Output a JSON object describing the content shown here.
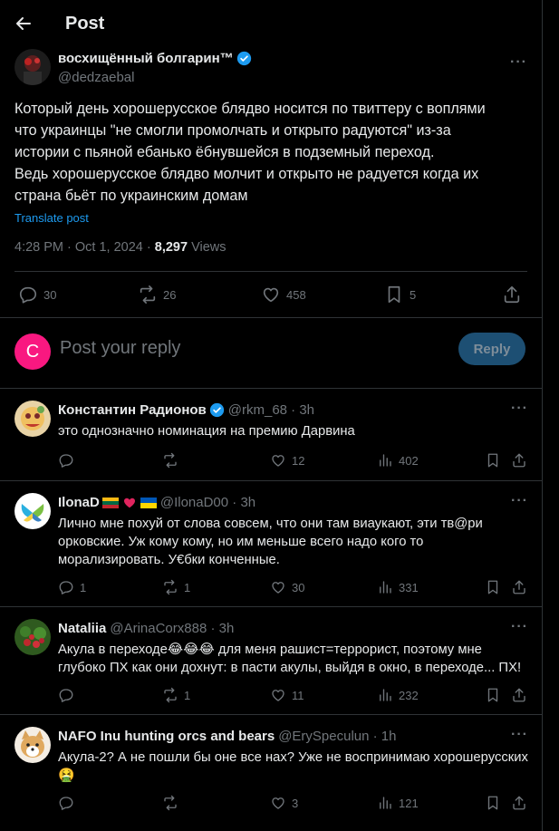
{
  "header": {
    "title": "Post"
  },
  "post": {
    "author_name": "восхищённый болгарин™",
    "author_handle": "@dedzaebal",
    "text_lines": [
      "Который день хорошерусское блядво носится по твиттеру с воплями",
      "что украинцы \"не смогли промолчать и открыто радуются\" из-за",
      "истории с пьяной ебанько ёбнувшейся в подземный переход.",
      "Ведь хорошерусское блядво молчит и открыто не радуется когда их",
      "страна бьёт по украинским домам"
    ],
    "translate": "Translate post",
    "time": "4:28 PM · Oct 1, 2024 · ",
    "views_count": "8,297",
    "views_label": " Views",
    "stats": {
      "replies": "30",
      "reposts": "26",
      "likes": "458",
      "bookmarks": "5"
    }
  },
  "reply_box": {
    "avatar_letter": "C",
    "placeholder": "Post your reply",
    "button": "Reply"
  },
  "replies": [
    {
      "name": "Константин Радионов",
      "handle": "@rkm_68 · 3h",
      "lines": [
        "это однозначно номинация на премию Дарвина"
      ],
      "replies": "",
      "reposts": "",
      "likes": "12",
      "views": "402"
    },
    {
      "name": "IlonaD",
      "handle": "@IlonaD00 · 3h",
      "lines": [
        "Лично мне похуй от слова совсем, что они там виаукают, эти тв@ри",
        "орковские. Уж кому кому, но им меньше всего надо кого то",
        "морализировать. У€бки конченные."
      ],
      "replies": "1",
      "reposts": "1",
      "likes": "30",
      "views": "331"
    },
    {
      "name": "Nataliia",
      "handle": "@ArinaCorx888 · 3h",
      "lines": [
        "Акула в переходе😂😂😂 для меня рашист=террорист, поэтому мне",
        "глубоко ПХ как они дохнут: в пасти акулы, выйдя в окно, в переходе... ПХ!"
      ],
      "replies": "",
      "reposts": "1",
      "likes": "11",
      "views": "232"
    },
    {
      "name": "NAFO Inu hunting orcs and bears",
      "handle": "@ErySpeculun · 1h",
      "lines": [
        "Акула-2? А не пошли бы оне все нах? Уже не воспринимаю хорошерусских",
        "🤮"
      ],
      "replies": "",
      "reposts": "",
      "likes": "3",
      "views": "121"
    }
  ],
  "colors": {
    "accent": "#1d9bf0",
    "muted": "#71767b",
    "border": "#2f3336",
    "reply_avatar": "#f91880"
  }
}
